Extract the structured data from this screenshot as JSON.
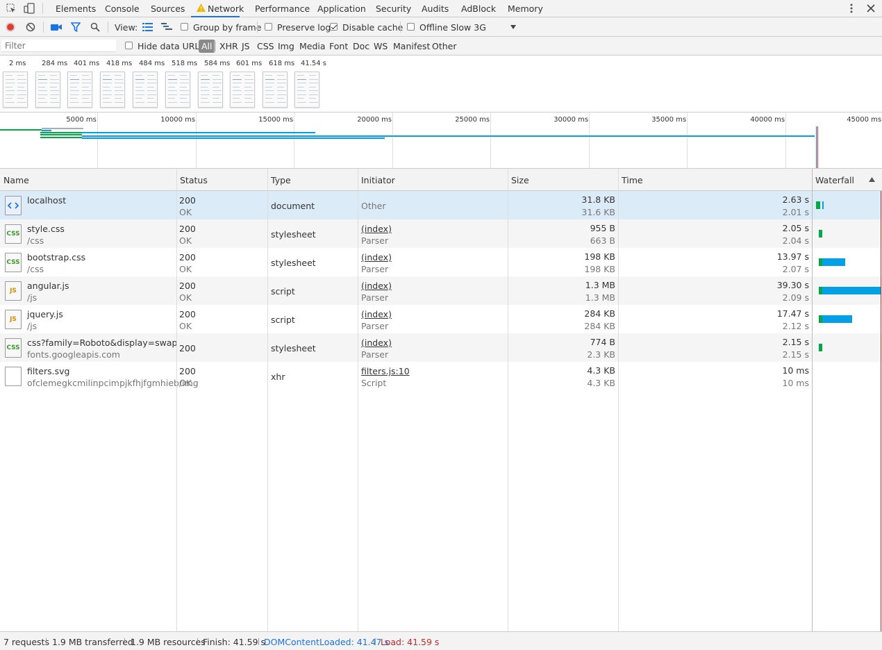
{
  "tabs": [
    {
      "label": "Elements",
      "name": "tab-elements"
    },
    {
      "label": "Console",
      "name": "tab-console"
    },
    {
      "label": "Sources",
      "name": "tab-sources"
    },
    {
      "label": "Network",
      "name": "tab-network",
      "selected": true
    },
    {
      "label": "Performance",
      "name": "tab-performance"
    },
    {
      "label": "Application",
      "name": "tab-application"
    },
    {
      "label": "Security",
      "name": "tab-security"
    },
    {
      "label": "Audits",
      "name": "tab-audits"
    },
    {
      "label": "AdBlock",
      "name": "tab-adblock"
    },
    {
      "label": "Memory",
      "name": "tab-memory"
    }
  ],
  "toolbar": {
    "view_label": "View:",
    "group_by_frame": "Group by frame",
    "preserve_log": "Preserve log",
    "disable_cache": "Disable cache",
    "disable_cache_checked": true,
    "offline": "Offline",
    "throttle": "Slow 3G"
  },
  "filterbar": {
    "placeholder": "Filter",
    "hide_data_urls": "Hide data URLs",
    "types": [
      "All",
      "XHR",
      "JS",
      "CSS",
      "Img",
      "Media",
      "Font",
      "Doc",
      "WS",
      "Manifest",
      "Other"
    ]
  },
  "filmstrip": [
    "2 ms",
    "284 ms",
    "401 ms",
    "418 ms",
    "484 ms",
    "518 ms",
    "584 ms",
    "601 ms",
    "618 ms",
    "41.54 s"
  ],
  "overview_ticks": [
    "5000 ms",
    "10000 ms",
    "15000 ms",
    "20000 ms",
    "25000 ms",
    "30000 ms",
    "35000 ms",
    "40000 ms",
    "45000 ms"
  ],
  "columns": {
    "name": "Name",
    "status": "Status",
    "type": "Type",
    "initiator": "Initiator",
    "size": "Size",
    "time": "Time",
    "waterfall": "Waterfall"
  },
  "requests": [
    {
      "name": "localhost",
      "path": "",
      "status": "200",
      "status_text": "OK",
      "type": "document",
      "initiator": "Other",
      "initiator_sub": "",
      "initiator_link": false,
      "size": "31.8 KB",
      "size_sub": "31.6 KB",
      "time": "2.63 s",
      "latency": "2.01 s",
      "icon": "html",
      "waterfall_ms": [
        2010,
        2630
      ]
    },
    {
      "name": "style.css",
      "path": "/css",
      "status": "200",
      "status_text": "OK",
      "type": "stylesheet",
      "initiator": "(index)",
      "initiator_sub": "Parser",
      "initiator_link": true,
      "size": "955 B",
      "size_sub": "663 B",
      "time": "2.05 s",
      "latency": "2.04 s",
      "icon": "css",
      "waterfall_ms": [
        2040,
        2050
      ]
    },
    {
      "name": "bootstrap.css",
      "path": "/css",
      "status": "200",
      "status_text": "OK",
      "type": "stylesheet",
      "initiator": "(index)",
      "initiator_sub": "Parser",
      "initiator_link": true,
      "size": "198 KB",
      "size_sub": "198 KB",
      "time": "13.97 s",
      "latency": "2.07 s",
      "icon": "css",
      "waterfall_ms": [
        2070,
        13970
      ]
    },
    {
      "name": "angular.js",
      "path": "/js",
      "status": "200",
      "status_text": "OK",
      "type": "script",
      "initiator": "(index)",
      "initiator_sub": "Parser",
      "initiator_link": true,
      "size": "1.3 MB",
      "size_sub": "1.3 MB",
      "time": "39.30 s",
      "latency": "2.09 s",
      "icon": "js",
      "waterfall_ms": [
        2090,
        39300
      ]
    },
    {
      "name": "jquery.js",
      "path": "/js",
      "status": "200",
      "status_text": "OK",
      "type": "script",
      "initiator": "(index)",
      "initiator_sub": "Parser",
      "initiator_link": true,
      "size": "284 KB",
      "size_sub": "284 KB",
      "time": "17.47 s",
      "latency": "2.12 s",
      "icon": "js",
      "waterfall_ms": [
        2120,
        17470
      ]
    },
    {
      "name": "css?family=Roboto&display=swap",
      "path": "fonts.googleapis.com",
      "status": "200",
      "status_text": "",
      "type": "stylesheet",
      "initiator": "(index)",
      "initiator_sub": "Parser",
      "initiator_link": true,
      "size": "774 B",
      "size_sub": "2.3 KB",
      "time": "2.15 s",
      "latency": "2.15 s",
      "icon": "css",
      "waterfall_ms": [
        2150,
        2150
      ]
    },
    {
      "name": "filters.svg",
      "path": "ofclemegkcmilinpcimpjkfhjfgmhieb/img",
      "status": "200",
      "status_text": "OK",
      "type": "xhr",
      "initiator": "filters.js:10",
      "initiator_sub": "Script",
      "initiator_link": true,
      "size": "4.3 KB",
      "size_sub": "4.3 KB",
      "time": "10 ms",
      "latency": "10 ms",
      "icon": "blank",
      "waterfall_ms": null
    }
  ],
  "status_bar": {
    "requests": "7 requests",
    "transferred": "1.9 MB transferred",
    "resources": "1.9 MB resources",
    "finish": "Finish: 41.59 s",
    "dcl": "DOMContentLoaded: 41.47 s",
    "load": "Load: 41.59 s"
  },
  "colors": {
    "accent": "#1a73e8",
    "record": "#e53935",
    "dcl": "#1a73e8",
    "load": "#c62828",
    "waterfall_wait": "#00a846",
    "waterfall_recv": "#03a0e8"
  }
}
